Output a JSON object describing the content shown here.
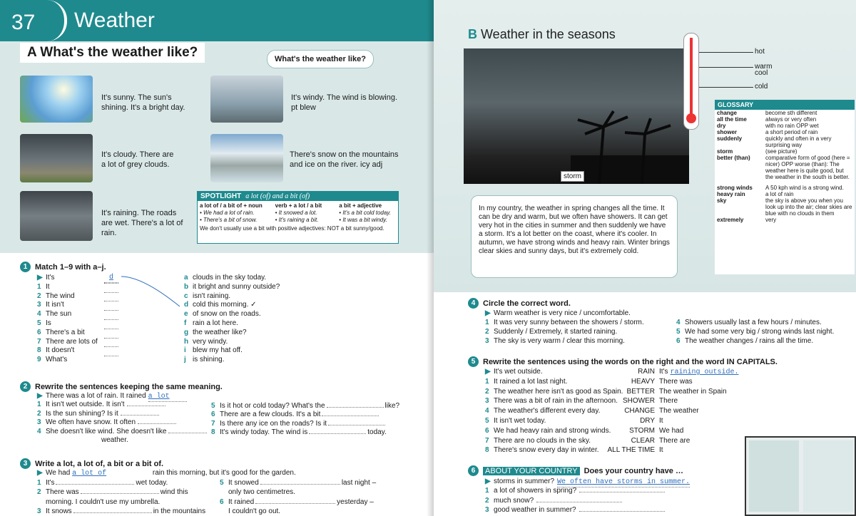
{
  "unit": {
    "number": "37",
    "title": "Weather"
  },
  "sectionA": {
    "title": "A What's the weather like?",
    "bubble": "What's the weather like?"
  },
  "captions": [
    {
      "text": "It's sunny. The sun's shining. It's a bright day."
    },
    {
      "text": "It's windy. The wind is blowing. pt blew"
    },
    {
      "text": "It's cloudy. There are a lot of grey clouds."
    },
    {
      "text": "There's snow on the mountains and ice on the river. icy adj"
    },
    {
      "text": "It's raining. The roads are wet. There's a lot of rain."
    }
  ],
  "spotlight": {
    "label": "SPOTLIGHT",
    "title": "a lot (of) and a bit (of)",
    "col1_head": "a lot of / a bit of + noun",
    "col1_ex1": "• We had a lot of rain.",
    "col1_ex2": "• There's a bit of snow.",
    "col2_head": "verb + a lot / a bit",
    "col2_ex1": "• It snowed a lot.",
    "col2_ex2": "• It's raining a bit.",
    "col3_head": "a bit + adjective",
    "col3_ex1": "• It's a bit cold today.",
    "col3_ex2": "• It was a bit windy.",
    "note": "We don't usually use a bit with positive adjectives: NOT a bit sunny/good."
  },
  "ex1": {
    "num": "1",
    "title": "Match 1–9 with a–j.",
    "left": [
      {
        "n": "▶",
        "t": "It's",
        "a": "d"
      },
      {
        "n": "1",
        "t": "It",
        "a": ""
      },
      {
        "n": "2",
        "t": "The wind",
        "a": ""
      },
      {
        "n": "3",
        "t": "It isn't",
        "a": ""
      },
      {
        "n": "4",
        "t": "The sun",
        "a": ""
      },
      {
        "n": "5",
        "t": "Is",
        "a": ""
      },
      {
        "n": "6",
        "t": "There's a bit",
        "a": ""
      },
      {
        "n": "7",
        "t": "There are lots of",
        "a": ""
      },
      {
        "n": "8",
        "t": "It doesn't",
        "a": ""
      },
      {
        "n": "9",
        "t": "What's",
        "a": ""
      }
    ],
    "right": [
      {
        "n": "a",
        "t": "clouds in the sky today."
      },
      {
        "n": "b",
        "t": "it bright and sunny outside?"
      },
      {
        "n": "c",
        "t": "isn't raining."
      },
      {
        "n": "d",
        "t": "cold this morning. ✓"
      },
      {
        "n": "e",
        "t": "of snow on the roads."
      },
      {
        "n": "f",
        "t": "rain a lot here."
      },
      {
        "n": "g",
        "t": "the weather like?"
      },
      {
        "n": "h",
        "t": "very windy."
      },
      {
        "n": "i",
        "t": "blew my hat off."
      },
      {
        "n": "j",
        "t": "is shining."
      }
    ]
  },
  "ex2": {
    "num": "2",
    "title": "Rewrite the sentences keeping the same meaning.",
    "left": [
      {
        "n": "▶",
        "t": "There was a lot of rain. It rained",
        "a": "a lot"
      },
      {
        "n": "1",
        "t": "It isn't wet outside. It isn't",
        "a": ""
      },
      {
        "n": "2",
        "t": "Is the sun shining? Is it",
        "a": ""
      },
      {
        "n": "3",
        "t": "We often have snow. It often",
        "a": ""
      },
      {
        "n": "4",
        "t": "She doesn't like wind. She doesn't like",
        "a": ""
      },
      {
        "n": "",
        "t": "weather.",
        "a": ""
      }
    ],
    "right": [
      {
        "n": "5",
        "t": "Is it hot or cold today? What's the",
        "end": "like?"
      },
      {
        "n": "6",
        "t": "There are a few clouds. It's a bit",
        "end": ""
      },
      {
        "n": "7",
        "t": "Is there any ice on the roads? Is it",
        "end": ""
      },
      {
        "n": "8",
        "t": "It's windy today. The wind is",
        "end": "today."
      }
    ]
  },
  "ex3": {
    "num": "3",
    "title": "Write a lot, a lot of, a bit or a bit of.",
    "example_pre": "We had",
    "example_ans": "a lot of",
    "example_post": "rain this morning, but it's good for the garden.",
    "left": [
      {
        "n": "1",
        "t": "It's",
        "end": "wet today."
      },
      {
        "n": "2",
        "t": "There was",
        "end": "wind this"
      },
      {
        "n": "",
        "t": "morning. I couldn't use my umbrella.",
        "end": ""
      },
      {
        "n": "3",
        "t": "It snows",
        "end": "in the mountains"
      }
    ],
    "right": [
      {
        "n": "5",
        "t": "It snowed",
        "end": "last night –"
      },
      {
        "n": "",
        "t": "only two centimetres.",
        "end": ""
      },
      {
        "n": "6",
        "t": "It rained",
        "end": "yesterday –"
      },
      {
        "n": "",
        "t": "I couldn't go out.",
        "end": ""
      }
    ]
  },
  "sectionB": {
    "letter": "B",
    "title": "Weather in the seasons",
    "storm_label": "storm"
  },
  "thermometer": {
    "hot": "hot",
    "warm": "warm",
    "cool": "cool",
    "cold": "cold"
  },
  "glossary": {
    "head": "GLOSSARY",
    "rows": [
      {
        "t": "change",
        "d": "become sth different"
      },
      {
        "t": "all the time",
        "d": "always or very often"
      },
      {
        "t": "dry",
        "d": "with no rain OPP wet"
      },
      {
        "t": "shower",
        "d": "a short period of rain"
      },
      {
        "t": "suddenly",
        "d": "quickly and often in a very surprising way"
      },
      {
        "t": "storm",
        "d": "(see picture)"
      },
      {
        "t": "better (than)",
        "d": "comparative form of good (here = nicer) OPP worse (than): The weather here is quite good, but the weather in the south is better."
      },
      {
        "t": "strong winds",
        "d": "A 50 kph wind is a strong wind."
      },
      {
        "t": "heavy rain",
        "d": "a lot of rain"
      },
      {
        "t": "sky",
        "d": "the sky is above you when you look up into the air; clear skies are blue with no clouds in them"
      },
      {
        "t": "extremely",
        "d": "very"
      }
    ]
  },
  "paragraph": "In my country, the weather in spring changes all the time. It can be dry and warm, but we often have showers. It can get very hot in the cities in summer and then suddenly we have a storm. It's a lot better on the coast, where it's cooler. In autumn, we have strong winds and heavy rain. Winter brings clear skies and sunny days, but it's extremely cold.",
  "ex4": {
    "num": "4",
    "title": "Circle the correct word.",
    "left": [
      {
        "n": "▶",
        "t": "Warm weather is very nice / uncomfortable."
      },
      {
        "n": "1",
        "t": "It was very sunny between the showers / storm."
      },
      {
        "n": "2",
        "t": "Suddenly / Extremely, it started raining."
      },
      {
        "n": "3",
        "t": "The sky is very warm / clear this morning."
      }
    ],
    "right": [
      {
        "n": "4",
        "t": "Showers usually last a few hours / minutes."
      },
      {
        "n": "5",
        "t": "We had some very big / strong winds last night."
      },
      {
        "n": "6",
        "t": "The weather changes / rains all the time."
      }
    ]
  },
  "ex5": {
    "num": "5",
    "title": "Rewrite the sentences using the words on the right and the word IN CAPITALS.",
    "rows": [
      {
        "n": "▶",
        "t": "It's wet outside.",
        "w": "RAIN",
        "s": "It's",
        "a": "raining outside."
      },
      {
        "n": "1",
        "t": "It rained a lot last night.",
        "w": "HEAVY",
        "s": "There was",
        "a": ""
      },
      {
        "n": "2",
        "t": "The weather here isn't as good as Spain.",
        "w": "BETTER",
        "s": "The weather in Spain",
        "a": ""
      },
      {
        "n": "3",
        "t": "There was a bit of rain in the afternoon.",
        "w": "SHOWER",
        "s": "There",
        "a": ""
      },
      {
        "n": "4",
        "t": "The weather's different every day.",
        "w": "CHANGE",
        "s": "The weather",
        "a": ""
      },
      {
        "n": "5",
        "t": "It isn't wet today.",
        "w": "DRY",
        "s": "It",
        "a": ""
      },
      {
        "n": "6",
        "t": "We had heavy rain and strong winds.",
        "w": "STORM",
        "s": "We had",
        "a": ""
      },
      {
        "n": "7",
        "t": "There are no clouds in the sky.",
        "w": "CLEAR",
        "s": "There are",
        "a": ""
      },
      {
        "n": "8",
        "t": "There's snow every day in winter.",
        "w": "ALL THE TIME",
        "s": "It",
        "a": ""
      }
    ]
  },
  "ex6": {
    "num": "6",
    "label": "ABOUT YOUR COUNTRY",
    "title": "Does your country have …",
    "rows": [
      {
        "n": "▶",
        "t": "storms in summer?",
        "a": "We often have storms in summer."
      },
      {
        "n": "1",
        "t": "a lot of showers in spring?",
        "a": ""
      },
      {
        "n": "2",
        "t": "much snow?",
        "a": ""
      },
      {
        "n": "3",
        "t": "good weather in summer?",
        "a": ""
      }
    ]
  },
  "colors": {
    "teal": "#1e8a8e",
    "handwriting": "#2f6fbe"
  }
}
